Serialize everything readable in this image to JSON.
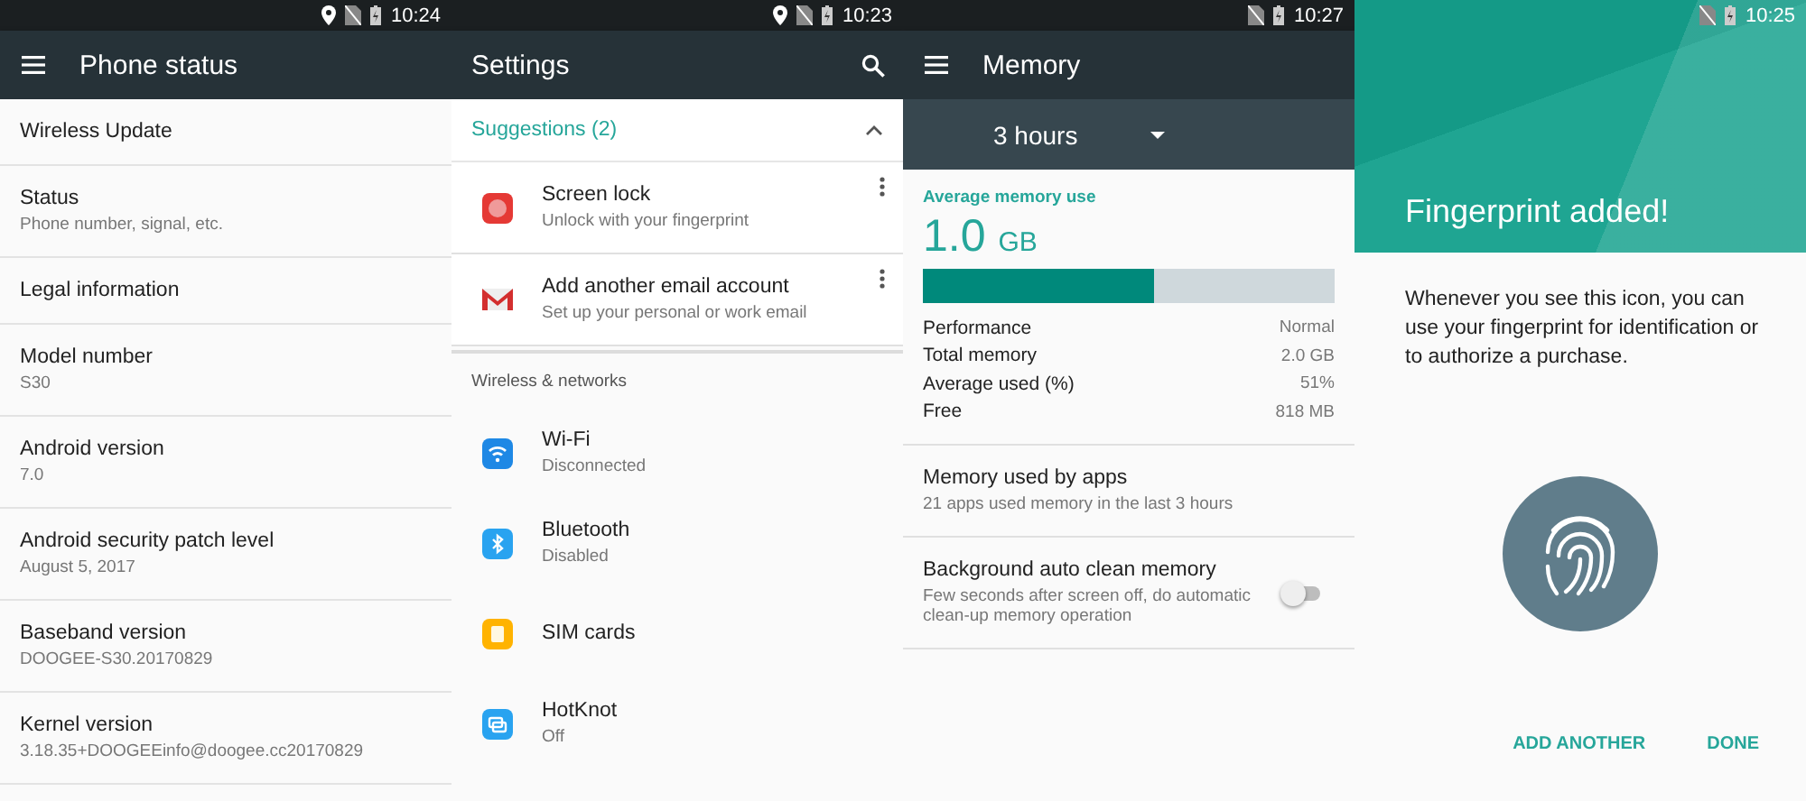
{
  "screens": [
    {
      "kind": "list",
      "status_bar": {
        "location": true,
        "time": "10:24"
      },
      "app_bar": {
        "title": "Phone status"
      },
      "items": [
        {
          "title": "Wireless Update"
        },
        {
          "title": "Status",
          "summary": "Phone number, signal, etc."
        },
        {
          "title": "Legal information"
        },
        {
          "title": "Model number",
          "summary": "S30"
        },
        {
          "title": "Android version",
          "summary": "7.0"
        },
        {
          "title": "Android security patch level",
          "summary": "August 5, 2017"
        },
        {
          "title": "Baseband version",
          "summary": "DOOGEE-S30.20170829"
        },
        {
          "title": "Kernel version",
          "summary": "3.18.35+DOOGEEinfo@doogee.cc20170829"
        }
      ]
    },
    {
      "kind": "settings",
      "status_bar": {
        "location": true,
        "time": "10:23"
      },
      "app_bar": {
        "title": "Settings"
      },
      "suggestions": {
        "title": "Suggestions (2)",
        "expanded": true,
        "items": [
          {
            "title": "Screen lock",
            "summary": "Unlock with your fingerprint"
          },
          {
            "title": "Add another email account",
            "summary": "Set up your personal or work email"
          }
        ]
      },
      "section": "Wireless & networks",
      "items": [
        {
          "title": "Wi-Fi",
          "summary": "Disconnected"
        },
        {
          "title": "Bluetooth",
          "summary": "Disabled"
        },
        {
          "title": "SIM cards"
        },
        {
          "title": "HotKnot",
          "summary": "Off"
        }
      ]
    },
    {
      "kind": "memory",
      "status_bar": {
        "location": false,
        "time": "10:27"
      },
      "app_bar": {
        "title": "Memory"
      },
      "period": "3 hours",
      "average_label": "Average memory use",
      "average_value": "1.0",
      "average_unit": "GB",
      "level": 0.56,
      "stats": [
        {
          "label": "Performance",
          "value": "Normal"
        },
        {
          "label": "Total memory",
          "value": "2.0 GB"
        },
        {
          "label": "Average used (%)",
          "value": "51%"
        },
        {
          "label": "Free",
          "value": "818 MB"
        }
      ],
      "items": [
        {
          "kind": "text",
          "title": "Memory used by apps",
          "summary": "21 apps used memory in the last 3 hours"
        },
        {
          "kind": "toggle",
          "title": "Background auto clean memory",
          "summary": "Few seconds after screen off, do automatic clean-up memory operation",
          "on": false
        }
      ]
    },
    {
      "kind": "fingerprint",
      "status_bar": {
        "location": false,
        "time": "10:25"
      },
      "title": "Fingerprint added!",
      "body": "Whenever you see this icon, you can use your fingerprint for identification or to authorize a purchase.",
      "buttons": [
        "ADD ANOTHER",
        "DONE"
      ]
    }
  ]
}
